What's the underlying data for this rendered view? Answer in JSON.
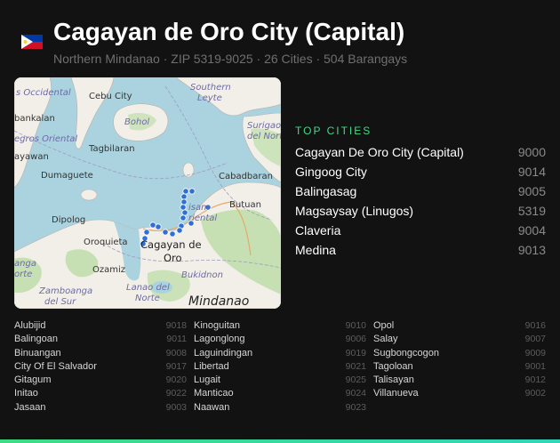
{
  "header": {
    "title": "Cagayan de Oro City (Capital)",
    "subtitle": "Northern Mindanao · ZIP 5319-9025 · 26 Cities · 504 Barangays",
    "flag_icon": "philippines-flag-icon"
  },
  "map": {
    "labels": {
      "cebu": "Cebu City",
      "bohol": "Bohol",
      "southern_leyte_1": "Southern",
      "southern_leyte_2": "Leyte",
      "negros_occidental": "s Occidental",
      "kabankalan": "bankalan",
      "negros_oriental": "egros Oriental",
      "tagbilaran": "Tagbilaran",
      "bayawan": "ayawan",
      "surigao_1": "Surigao",
      "surigao_2": "del Norte",
      "dumaguete": "Dumaguete",
      "cabadbaran": "Cabadbaran",
      "butuan": "Butuan",
      "misamis_1": "isam",
      "misamis_2": "riental",
      "dipolog": "Dipolog",
      "oroquieta": "Oroquieta",
      "cdo_1": "Cagayan de",
      "cdo_2": "Oro",
      "ozamiz": "Ozamiz",
      "zamboanga_1": "anga",
      "zamboanga_2": "orte",
      "zamboanga_sur_1": "Zamboanga",
      "zamboanga_sur_2": "del Sur",
      "lanao_1": "Lanao del",
      "lanao_2": "Norte",
      "bukidnon": "Bukidnon",
      "mindanao": "Mindanao"
    }
  },
  "top_cities": {
    "heading": "TOP CITIES",
    "items": [
      {
        "name": "Cagayan De Oro City (Capital)",
        "zip": "9000"
      },
      {
        "name": "Gingoog City",
        "zip": "9014"
      },
      {
        "name": "Balingasag",
        "zip": "9005"
      },
      {
        "name": "Magsaysay (Linugos)",
        "zip": "5319"
      },
      {
        "name": "Claveria",
        "zip": "9004"
      },
      {
        "name": "Medina",
        "zip": "9013"
      }
    ]
  },
  "city_list": {
    "columns": [
      [
        {
          "name": "Alubijid",
          "zip": "9018"
        },
        {
          "name": "Balingoan",
          "zip": "9011"
        },
        {
          "name": "Binuangan",
          "zip": "9008"
        },
        {
          "name": "City Of El Salvador",
          "zip": "9017"
        },
        {
          "name": "Gitagum",
          "zip": "9020"
        },
        {
          "name": "Initao",
          "zip": "9022"
        },
        {
          "name": "Jasaan",
          "zip": "9003"
        }
      ],
      [
        {
          "name": "Kinoguitan",
          "zip": "9010"
        },
        {
          "name": "Lagonglong",
          "zip": "9006"
        },
        {
          "name": "Laguindingan",
          "zip": "9019"
        },
        {
          "name": "Libertad",
          "zip": "9021"
        },
        {
          "name": "Lugait",
          "zip": "9025"
        },
        {
          "name": "Manticao",
          "zip": "9024"
        },
        {
          "name": "Naawan",
          "zip": "9023"
        }
      ],
      [
        {
          "name": "Opol",
          "zip": "9016"
        },
        {
          "name": "Salay",
          "zip": "9007"
        },
        {
          "name": "Sugbongcogon",
          "zip": "9009"
        },
        {
          "name": "Tagoloan",
          "zip": "9001"
        },
        {
          "name": "Talisayan",
          "zip": "9012"
        },
        {
          "name": "Villanueva",
          "zip": "9002"
        }
      ]
    ]
  },
  "colors": {
    "accent": "#3ddc84",
    "water": "#aad3df",
    "land": "#f2efe9",
    "forest": "#c6e0b4",
    "marker": "#2f6fd6"
  }
}
